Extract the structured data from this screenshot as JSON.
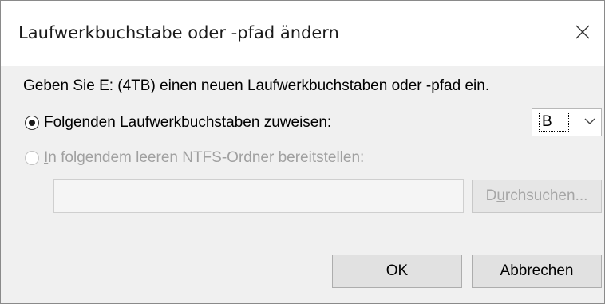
{
  "dialog": {
    "title": "Laufwerkbuchstabe oder -pfad ändern",
    "close_icon": "close-icon",
    "description": "Geben Sie E: (4TB) einen neuen Laufwerkbuchstaben oder -pfad ein."
  },
  "option_letter": {
    "label_pre": "Folgenden ",
    "label_accel": "L",
    "label_post": "aufwerkbuchstaben zuweisen:",
    "selected": true
  },
  "letter_select": {
    "value": "B",
    "icon": "chevron-down-icon"
  },
  "option_folder": {
    "label_accel": "I",
    "label_post": "n folgendem leeren NTFS-Ordner bereitstellen:",
    "selected": false,
    "enabled": false
  },
  "folder_path": {
    "value": ""
  },
  "browse_button": {
    "label_pre": "D",
    "label_accel": "u",
    "label_post": "rchsuchen...",
    "enabled": false
  },
  "footer": {
    "ok_label": "OK",
    "cancel_label": "Abbrechen"
  }
}
